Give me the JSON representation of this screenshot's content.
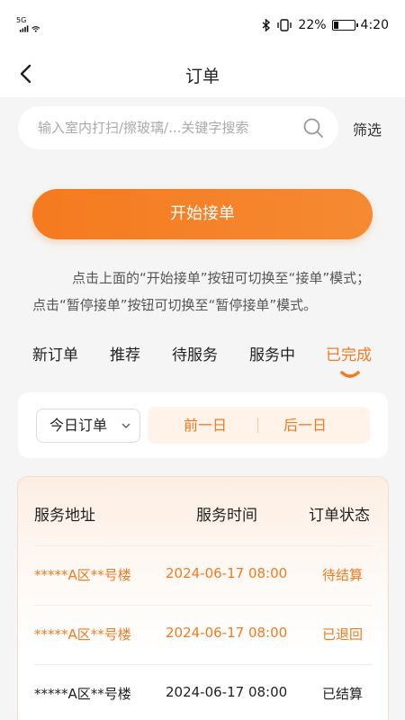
{
  "status_bar": {
    "network": "5G",
    "battery": "22%",
    "time": "4:20",
    "battery_level": 0.22
  },
  "nav": {
    "title": "订单"
  },
  "search": {
    "placeholder": "输入室内打扫/擦玻璃/...关键字搜索",
    "filter_label": "筛选"
  },
  "start_button": {
    "label": "开始接单"
  },
  "hint": "点击上面的“开始接单”按钮可切换至“接单”模式；点击“暂停接单”按钮可切换至“暂停接单”模式。",
  "tabs": [
    {
      "label": "新订单",
      "active": false
    },
    {
      "label": "推荐",
      "active": false
    },
    {
      "label": "待服务",
      "active": false
    },
    {
      "label": "服务中",
      "active": false
    },
    {
      "label": "已完成",
      "active": true
    }
  ],
  "date_filter": {
    "selected": "今日订单",
    "prev_label": "前一日",
    "next_label": "后一日"
  },
  "table": {
    "headers": [
      "服务地址",
      "服务时间",
      "订单状态"
    ],
    "rows": [
      {
        "address": "*****A区**号楼",
        "time": "2024-06-17 08:00",
        "status": "待结算"
      },
      {
        "address": "*****A区**号楼",
        "time": "2024-06-17 08:00",
        "status": "已退回"
      },
      {
        "address": "*****A区**号楼",
        "time": "2024-06-17 08:00",
        "status": "已结算"
      }
    ]
  },
  "colors": {
    "accent": "#f57a1f",
    "background": "#f5f5f5"
  }
}
